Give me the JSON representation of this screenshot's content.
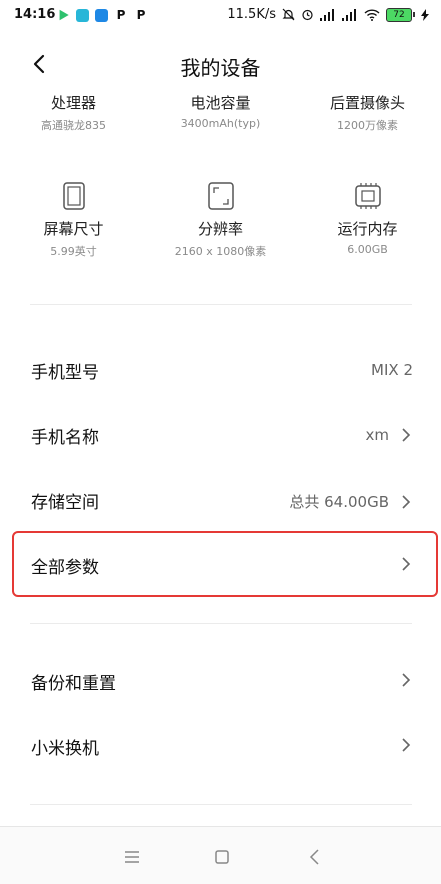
{
  "status": {
    "time": "14:16",
    "network_speed": "11.5K/s",
    "battery": "72"
  },
  "header": {
    "title": "我的设备"
  },
  "specs": [
    {
      "label": "处理器",
      "value": "高通骁龙835",
      "icon": "cpu-icon"
    },
    {
      "label": "电池容量",
      "value": "3400mAh(typ)",
      "icon": "battery-icon"
    },
    {
      "label": "后置摄像头",
      "value": "1200万像素",
      "icon": "camera-icon"
    },
    {
      "label": "屏幕尺寸",
      "value": "5.99英寸",
      "icon": "screen-size-icon"
    },
    {
      "label": "分辨率",
      "value": "2160 x 1080像素",
      "icon": "resolution-icon"
    },
    {
      "label": "运行内存",
      "value": "6.00GB",
      "icon": "memory-icon"
    }
  ],
  "rows": {
    "model": {
      "label": "手机型号",
      "value": "MIX 2"
    },
    "name": {
      "label": "手机名称",
      "value": "xm"
    },
    "storage": {
      "label": "存储空间",
      "value": "总共 64.00GB"
    },
    "all_params": {
      "label": "全部参数"
    },
    "backup": {
      "label": "备份和重置"
    },
    "mi_mover": {
      "label": "小米换机"
    }
  },
  "colors": {
    "highlight": "#e53935",
    "battery": "#4cd964"
  }
}
